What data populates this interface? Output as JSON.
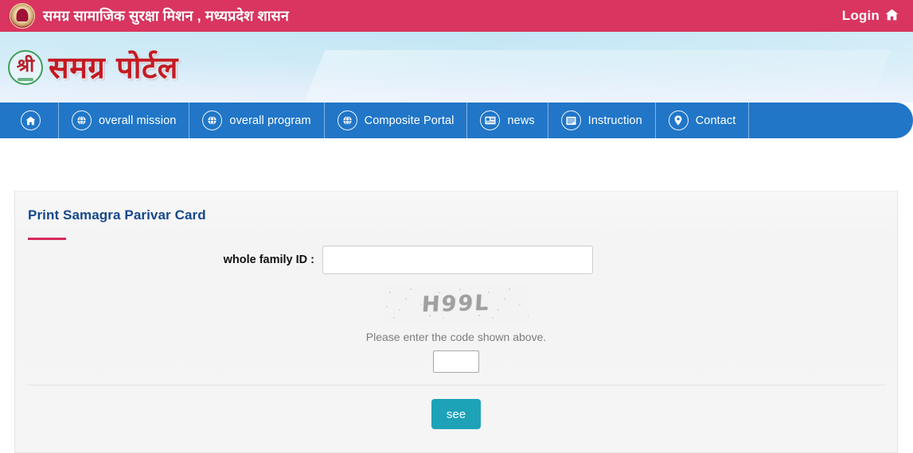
{
  "topbar": {
    "emblem_icon": "mp-state-emblem-icon",
    "gov_title": "समग्र सामाजिक सुरक्षा मिशन , मध्यप्रदेश शासन",
    "login_label": "Login",
    "home_icon": "home-icon",
    "background_color": "#d93560"
  },
  "banner": {
    "logo_mark_text": "श्री",
    "logo_text": "समग्र पोर्टल",
    "background_color": "#cbe9f6"
  },
  "nav": {
    "background_color": "#2176c7",
    "items": [
      {
        "label": "",
        "icon": "home-icon"
      },
      {
        "label": "overall mission",
        "icon": "globe-icon"
      },
      {
        "label": "overall program",
        "icon": "globe-icon"
      },
      {
        "label": "Composite Portal",
        "icon": "globe-icon"
      },
      {
        "label": "news",
        "icon": "newspaper-icon"
      },
      {
        "label": "Instruction",
        "icon": "list-icon"
      },
      {
        "label": "Contact",
        "icon": "location-pin-icon"
      }
    ]
  },
  "card": {
    "title": "Print Samagra Parivar Card",
    "title_color": "#16488c",
    "accent_color": "#d6295b",
    "family_id": {
      "label": "whole family ID :",
      "value": "",
      "placeholder": ""
    },
    "captcha": {
      "code": "H99L",
      "hint": "Please enter the code shown above.",
      "value": "",
      "placeholder": ""
    },
    "submit_label": "see",
    "submit_color": "#1da2b8"
  }
}
